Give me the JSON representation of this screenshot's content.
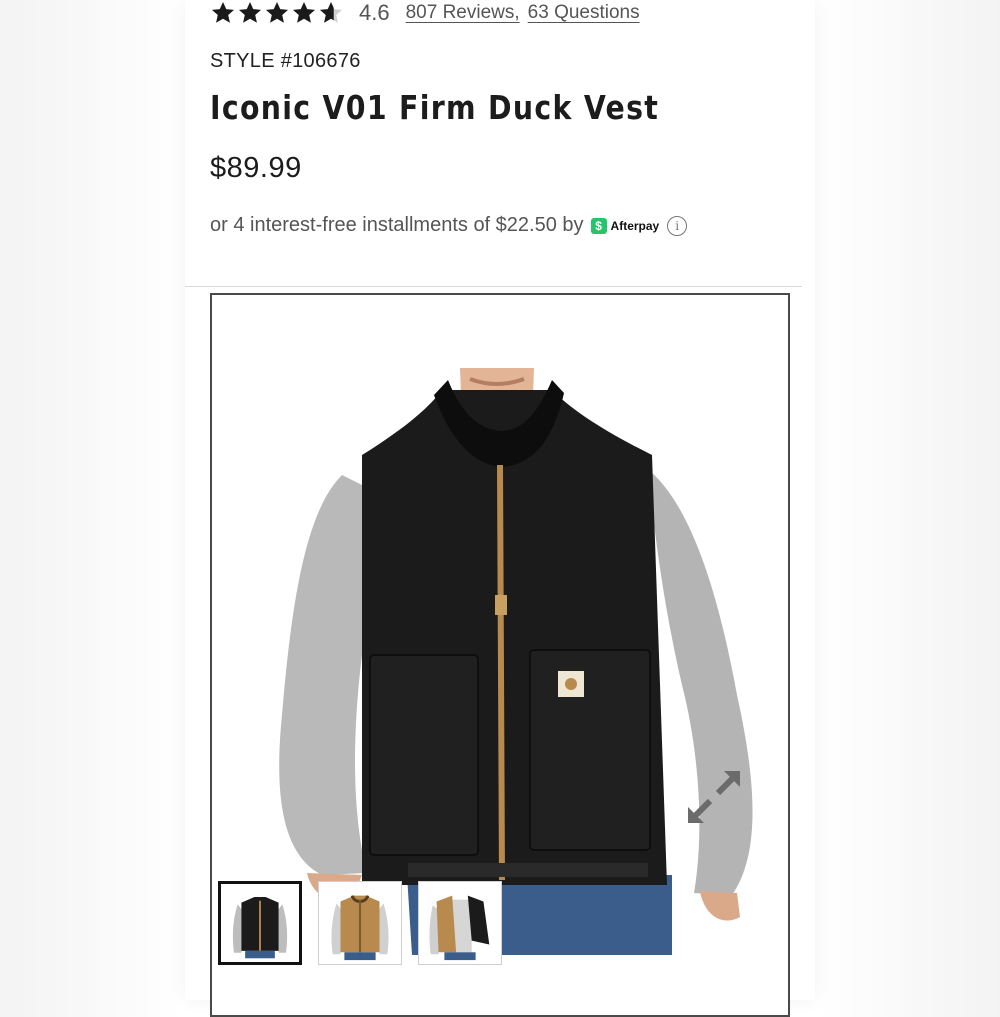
{
  "product": {
    "rating": 4.6,
    "rating_text": "4.6",
    "reviews_link": "807 Reviews,",
    "questions_link": "63 Questions",
    "style_number": "STYLE #106676",
    "title": "Iconic V01 Firm Duck Vest",
    "price": "$89.99",
    "afterpay_text": "or 4 interest-free installments of $22.50 by",
    "afterpay_brand": "Afterpay",
    "afterpay_badge": "$"
  },
  "colors": {
    "star": "#1a1a1a",
    "afterpay_green": "#27c46b",
    "text_muted": "#555555",
    "vest_black": "#1b1b1b",
    "vest_brown": "#b88a4e"
  },
  "gallery": {
    "main_image_icon": "product-photo-black-vest",
    "expand_icon": "expand-arrows-icon",
    "thumbnails": [
      {
        "name": "black-vest-front",
        "selected": true
      },
      {
        "name": "brown-vest-front",
        "selected": false
      },
      {
        "name": "brown-vest-open",
        "selected": false
      }
    ]
  }
}
